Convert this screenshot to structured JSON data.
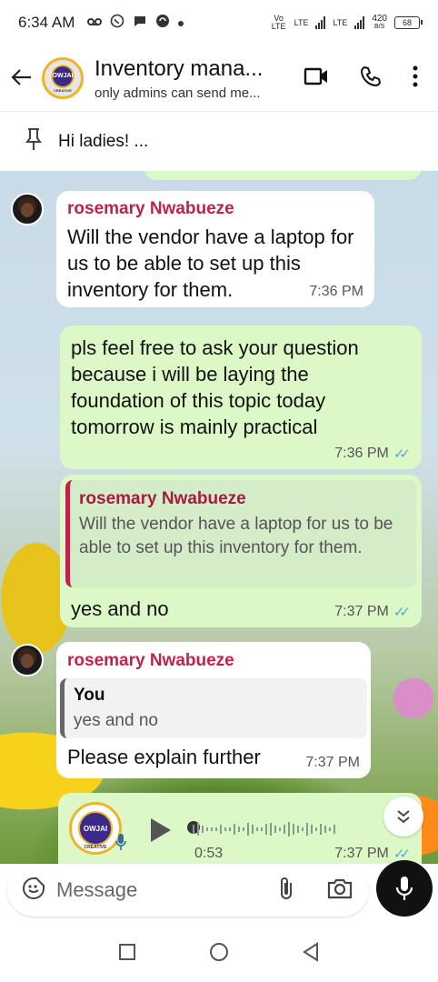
{
  "status_bar": {
    "time": "6:34 AM",
    "net_speed_value": "420",
    "net_speed_unit": "B/S",
    "battery": "68",
    "sim1_label": "Vo LTE",
    "sim1_tech": "LTE",
    "sim2_tech": "LTE"
  },
  "header": {
    "title": "Inventory mana...",
    "subtitle": "only admins can send me...",
    "avatar_text": "OWJAI",
    "avatar_subtext": "CREATIVE"
  },
  "pinned": {
    "text": "Hi ladies! ..."
  },
  "messages": [
    {
      "sender": "rosemary Nwabueze",
      "text": "Will the vendor have a laptop for us to be able to set up this inventory for them.",
      "time": "7:36 PM"
    },
    {
      "text": "pls feel free to ask your question because i will be laying the foundation of this topic today tomorrow is mainly practical",
      "time": "7:36 PM"
    },
    {
      "quote_sender": "rosemary Nwabueze",
      "quote_text": "Will the vendor have a laptop for us to be able to set up this inventory for them.",
      "text": "yes and no",
      "time": "7:37 PM"
    },
    {
      "sender": "rosemary Nwabueze",
      "quote_sender": "You",
      "quote_text": "yes and no",
      "text": "Please explain further",
      "time": "7:37 PM"
    },
    {
      "duration": "0:53",
      "time": "7:37 PM",
      "avatar_text": "OWJAI",
      "avatar_subtext": "CREATIVE"
    }
  ],
  "composer": {
    "placeholder": "Message"
  },
  "colors": {
    "sender_name": "#c0224d",
    "outgoing_bubble": "#dcf8c6",
    "incoming_bubble": "#ffffff",
    "read_ticks": "#53a6d6"
  }
}
